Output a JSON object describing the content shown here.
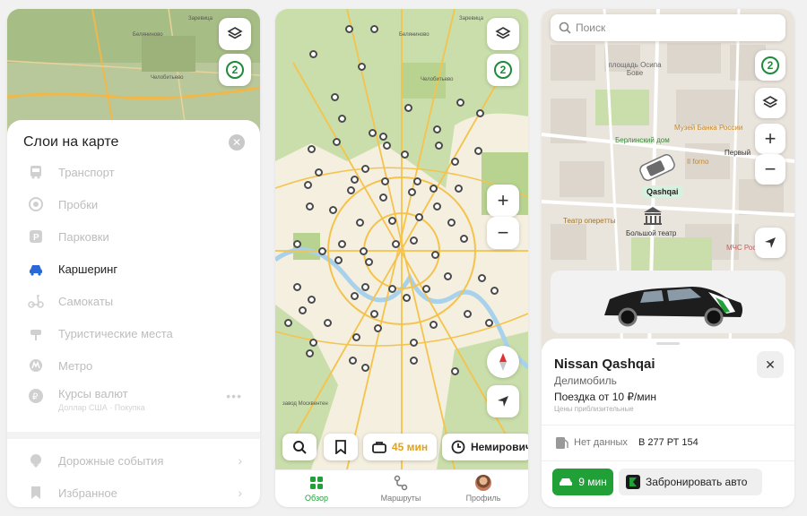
{
  "panel1": {
    "map_labels": [
      "Заревица",
      "Беляниново",
      "Челобитьево"
    ],
    "badge": "2",
    "sheet_title": "Слои на карте",
    "layers": [
      {
        "label": "Транспорт",
        "icon": "bus-icon",
        "active": false
      },
      {
        "label": "Пробки",
        "icon": "traffic-icon",
        "active": false
      },
      {
        "label": "Парковки",
        "icon": "parking-icon",
        "active": false
      },
      {
        "label": "Каршеринг",
        "icon": "carsharing-icon",
        "active": true
      },
      {
        "label": "Самокаты",
        "icon": "scooter-icon",
        "active": false
      },
      {
        "label": "Туристические места",
        "icon": "landmark-icon",
        "active": false
      },
      {
        "label": "Метро",
        "icon": "metro-icon",
        "active": false
      },
      {
        "label": "Курсы валют",
        "sublabel": "Доллар США · Покупка",
        "icon": "currency-icon",
        "active": false
      }
    ],
    "extra_layers": [
      {
        "label": "Дорожные события",
        "icon": "road-event-icon"
      },
      {
        "label": "Избранное",
        "icon": "bookmark-icon"
      }
    ]
  },
  "panel2": {
    "map_labels": [
      "Заревица",
      "Беляниново",
      "Челобитьево",
      "завод Москвентен"
    ],
    "badge": "2",
    "eta": "45 мин",
    "location": "Немирович",
    "tabs": [
      "Обзор",
      "Маршруты",
      "Профиль"
    ]
  },
  "panel3": {
    "search_placeholder": "Поиск",
    "badge": "2",
    "map_labels": [
      "площадь Осипа Бове",
      "Берлинский дом",
      "Музей Банка России",
      "Il forno",
      "Театр оперетты",
      "Большой театр",
      "Первый",
      "МЧС России"
    ],
    "car_tag": "Qashqai",
    "car": {
      "name": "Nissan Qashqai",
      "company": "Делимобиль",
      "price": "Поездка от 10 ₽/мин",
      "price_note": "Цены приблизительные",
      "fuel": "Нет данных",
      "plate": "В 277 РТ 154",
      "walk_time": "9 мин",
      "book_label": "Забронировать авто"
    }
  },
  "colors": {
    "accent": "#21a038",
    "map_bg": "#f4efdf",
    "map_green": "#c9deaa",
    "road": "#f5c34c",
    "water": "#a8d1ec"
  }
}
